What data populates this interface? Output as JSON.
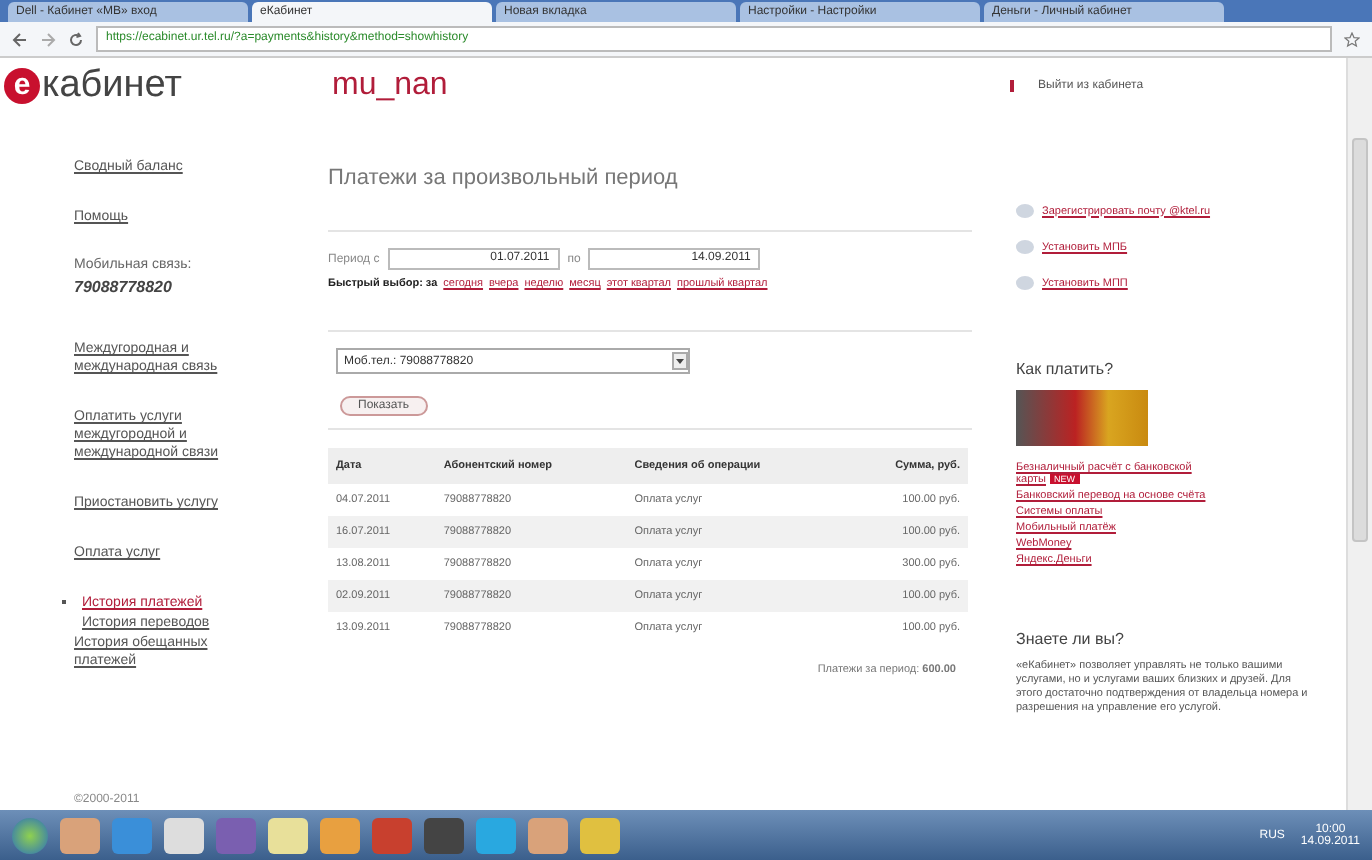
{
  "browser": {
    "tabs": [
      {
        "title": "Dell - Кабинет «МВ» вход",
        "selected": false
      },
      {
        "title": "еКабинет",
        "selected": true
      },
      {
        "title": "Новая вкладка",
        "selected": false
      },
      {
        "title": "Настройки - Настройки",
        "selected": false
      },
      {
        "title": "Деньги - Личный кабинет",
        "selected": false
      }
    ],
    "url": "https://ecabinet.ur.tel.ru/?a=payments&history&method=showhistory"
  },
  "header": {
    "logo_mark": "е",
    "logo_text": "кабинет",
    "username": "mu_nan",
    "logout": "Выйти из кабинета"
  },
  "sidebar": [
    {
      "kind": "link",
      "label": "Сводный баланс",
      "selected": false
    },
    {
      "kind": "link",
      "label": "Помощь",
      "selected": false
    },
    {
      "kind": "label",
      "label": "Мобильная связь:"
    },
    {
      "kind": "number",
      "label": "79088778820"
    },
    {
      "kind": "link",
      "label": "Междугородная и международная связь",
      "selected": false
    },
    {
      "kind": "link",
      "label": "Оплатить услуги междугородной и международной связи",
      "selected": false
    },
    {
      "kind": "link",
      "label": "Приостановить услугу",
      "selected": false
    },
    {
      "kind": "link",
      "label": "Оплата услуг",
      "selected": false
    },
    {
      "kind": "sublink",
      "label": "История платежей",
      "selected": true
    },
    {
      "kind": "sublink",
      "label": "История переводов",
      "selected": false
    },
    {
      "kind": "link",
      "label": "История обещанных платежей",
      "selected": false
    }
  ],
  "main": {
    "title": "Платежи за произвольный период",
    "period": {
      "from_label": "Период с",
      "from": "01.07.2011",
      "to_label": "по",
      "to": "14.09.2011"
    },
    "quick": {
      "label": "Быстрый выбор: за",
      "links": [
        "сегодня",
        "вчера",
        "неделю",
        "месяц",
        "этот квартал",
        "прошлый квартал"
      ]
    },
    "account_select": "Моб.тел.: 79088778820",
    "show_button": "Показать",
    "table": {
      "columns": [
        "Дата",
        "Абонентский номер",
        "Сведения об операции",
        "Сумма, руб."
      ],
      "rows": [
        [
          "04.07.2011",
          "79088778820",
          "Оплата услуг",
          "100.00 руб."
        ],
        [
          "16.07.2011",
          "79088778820",
          "Оплата услуг",
          "100.00 руб."
        ],
        [
          "13.08.2011",
          "79088778820",
          "Оплата услуг",
          "300.00 руб."
        ],
        [
          "02.09.2011",
          "79088778820",
          "Оплата услуг",
          "100.00 руб."
        ],
        [
          "13.09.2011",
          "79088778820",
          "Оплата услуг",
          "100.00 руб."
        ]
      ]
    },
    "total_label": "Платежи за период:",
    "total": "600.00"
  },
  "right": {
    "links": [
      "Зарегистрировать почту @ktel.ru",
      "Установить МПБ",
      "Установить МПП"
    ],
    "pay_title": "Как платить?",
    "pay_methods": [
      {
        "label": "Безналичный расчёт с банковской карты",
        "badge": "NEW"
      },
      {
        "label": "Банковский перевод на основе счёта"
      },
      {
        "label": "Системы оплаты"
      },
      {
        "label": "Мобильный платёж"
      },
      {
        "label": "WebMoney"
      },
      {
        "label": "Яндекс.Деньги"
      }
    ],
    "tip_title": "Знаете ли вы?",
    "tip_text": "«еКабинет» позволяет управлять не только вашими услугами, но и услугами ваших близких и друзей. Для этого достаточно подтверждения от владельца номера и разрешения на управление его услугой."
  },
  "footer": "©2000-2011",
  "taskbar": {
    "language": "RUS",
    "time": "10:00",
    "date": "14.09.2011"
  }
}
